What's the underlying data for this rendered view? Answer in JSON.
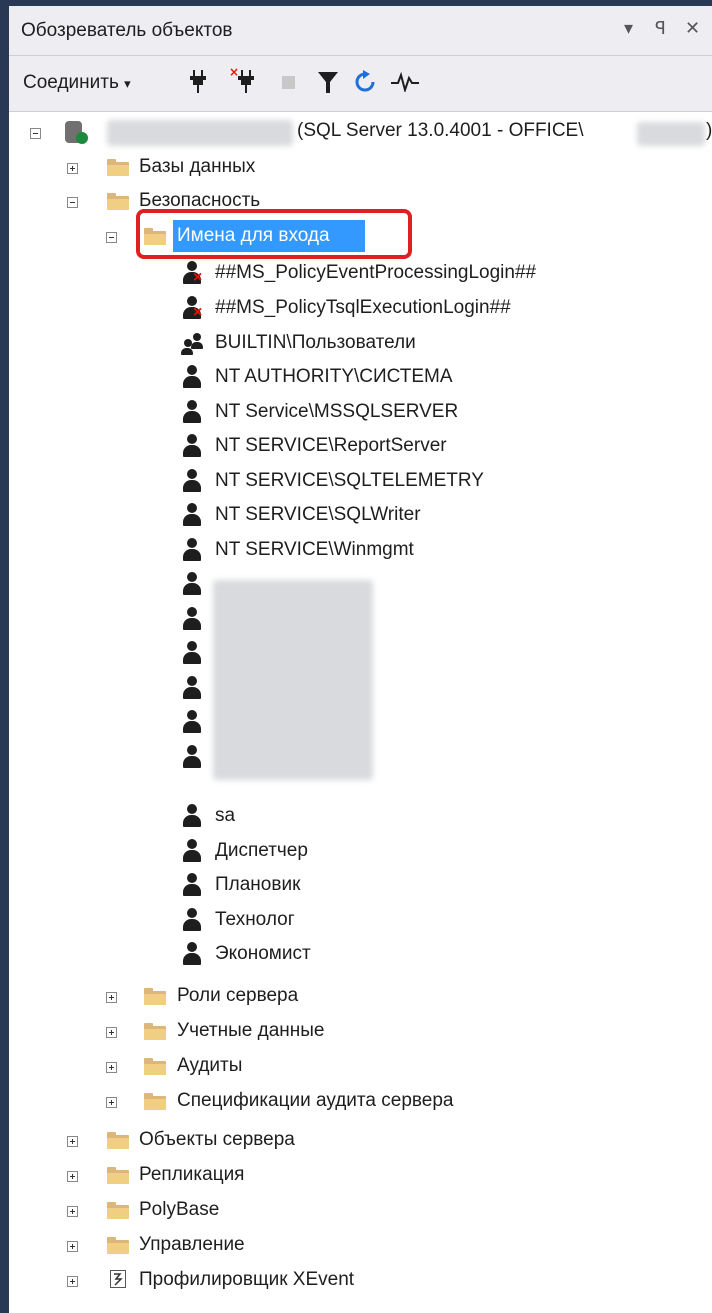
{
  "window": {
    "title": "Обозреватель объектов",
    "pin_glyph": "▾ ꟼ ✕"
  },
  "toolbar": {
    "connect_label": "Соединить",
    "connect_arrow": "▾",
    "icons": [
      "connect-plug-icon",
      "disconnect-plug-icon",
      "stop-icon",
      "filter-icon",
      "refresh-icon",
      "activity-monitor-icon"
    ]
  },
  "tree": {
    "server": {
      "label": "(SQL Server 13.0.4001 - OFFICE\\",
      "suffix": ")"
    },
    "databases": "Базы данных",
    "security": "Безопасность",
    "logins_folder": "Имена для входа",
    "logins": [
      {
        "name": "##MS_PolicyEventProcessingLogin##",
        "icon": "user-disabled-icon"
      },
      {
        "name": "##MS_PolicyTsqlExecutionLogin##",
        "icon": "user-disabled-icon"
      },
      {
        "name": "BUILTIN\\Пользователи",
        "icon": "group-icon"
      },
      {
        "name": "NT AUTHORITY\\СИСТЕМА",
        "icon": "user-icon"
      },
      {
        "name": "NT Service\\MSSQLSERVER",
        "icon": "user-icon"
      },
      {
        "name": "NT SERVICE\\ReportServer",
        "icon": "user-icon"
      },
      {
        "name": "NT SERVICE\\SQLTELEMETRY",
        "icon": "user-icon"
      },
      {
        "name": "NT SERVICE\\SQLWriter",
        "icon": "user-icon"
      },
      {
        "name": "NT SERVICE\\Winmgmt",
        "icon": "user-icon"
      }
    ],
    "logins_after": [
      {
        "name": "sa"
      },
      {
        "name": "Диспетчер"
      },
      {
        "name": "Плановик"
      },
      {
        "name": "Технолог"
      },
      {
        "name": "Экономист"
      }
    ],
    "security_folders": [
      "Роли сервера",
      "Учетные данные",
      "Аудиты",
      "Спецификации аудита сервера"
    ],
    "server_folders": [
      "Объекты сервера",
      "Репликация",
      "PolyBase",
      "Управление"
    ],
    "xevent": "Профилировщик XEvent"
  },
  "colors": {
    "selection": "#3399ff",
    "highlight_box": "#e02020",
    "frame": "#293955",
    "folder": "#dcb67a"
  }
}
